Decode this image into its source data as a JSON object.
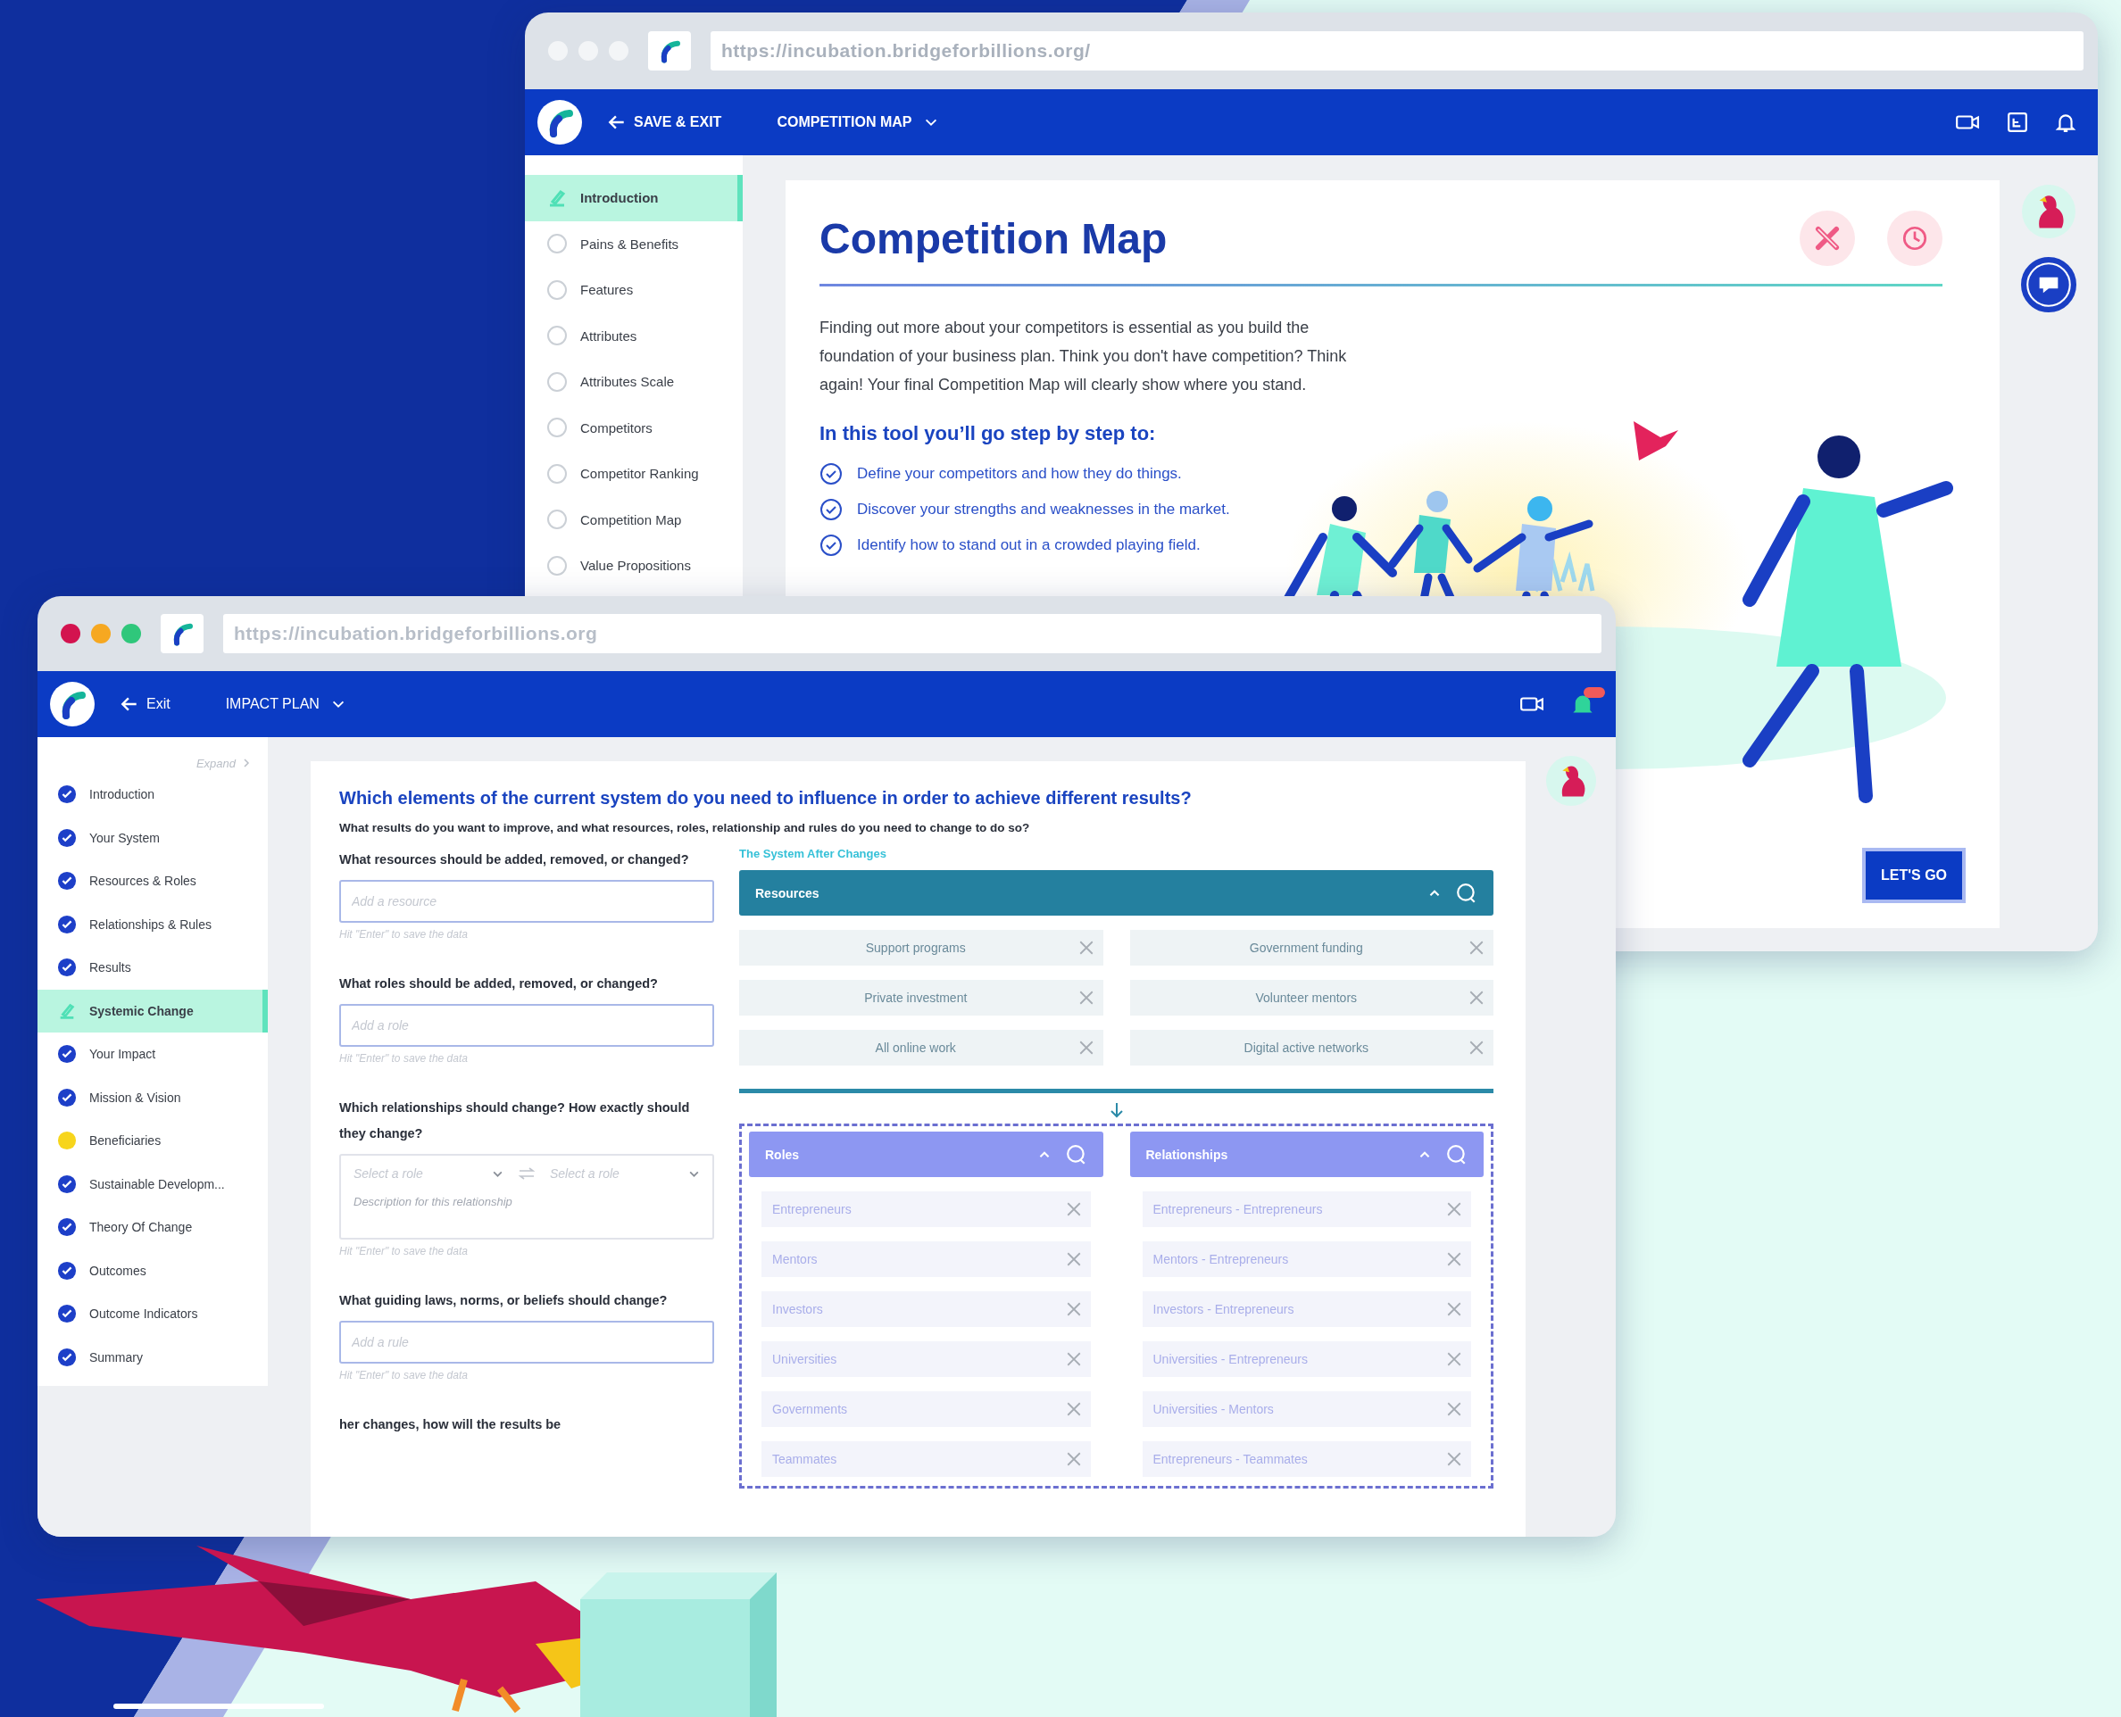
{
  "back_window": {
    "url": "https://incubation.bridgeforbillions.org/",
    "nav": {
      "back_label": "SAVE & EXIT",
      "section": "COMPETITION MAP"
    },
    "sidebar": [
      {
        "label": "Introduction",
        "kind": "current",
        "selected": true
      },
      {
        "label": "Pains & Benefits",
        "kind": "todo",
        "selected": false
      },
      {
        "label": "Features",
        "kind": "todo",
        "selected": false
      },
      {
        "label": "Attributes",
        "kind": "todo",
        "selected": false
      },
      {
        "label": "Attributes Scale",
        "kind": "todo",
        "selected": false
      },
      {
        "label": "Competitors",
        "kind": "todo",
        "selected": false
      },
      {
        "label": "Competitor Ranking",
        "kind": "todo",
        "selected": false
      },
      {
        "label": "Competition Map",
        "kind": "todo",
        "selected": false
      },
      {
        "label": "Value Propositions",
        "kind": "todo",
        "selected": false
      }
    ],
    "title": "Competition Map",
    "intro": "Finding out more about your competitors is essential as you build the foundation of your business plan. Think you don't have competition? Think again! Your final Competition Map will clearly show where you stand.",
    "steps_heading": "In this tool you’ll go step by step to:",
    "steps": [
      "Define your competitors and how they do things.",
      "Discover your strengths and weaknesses in the market.",
      "Identify how to stand out in a crowded playing field."
    ],
    "primary_button": "LET'S GO"
  },
  "front_window": {
    "url": "https://incubation.bridgeforbillions.org",
    "nav": {
      "back_label": "Exit",
      "section": "IMPACT PLAN"
    },
    "sidebar": {
      "expand": "Expand",
      "items": [
        {
          "label": "Introduction",
          "kind": "done",
          "selected": false
        },
        {
          "label": "Your System",
          "kind": "done",
          "selected": false
        },
        {
          "label": "Resources & Roles",
          "kind": "done",
          "selected": false
        },
        {
          "label": "Relationships & Rules",
          "kind": "done",
          "selected": false
        },
        {
          "label": "Results",
          "kind": "done",
          "selected": false
        },
        {
          "label": "Systemic Change",
          "kind": "current",
          "selected": true
        },
        {
          "label": "Your Impact",
          "kind": "done",
          "selected": false
        },
        {
          "label": "Mission & Vision",
          "kind": "done",
          "selected": false
        },
        {
          "label": "Beneficiaries",
          "kind": "partial",
          "selected": false
        },
        {
          "label": "Sustainable Developm...",
          "kind": "done",
          "selected": false
        },
        {
          "label": "Theory Of Change",
          "kind": "done",
          "selected": false
        },
        {
          "label": "Outcomes",
          "kind": "done",
          "selected": false
        },
        {
          "label": "Outcome Indicators",
          "kind": "done",
          "selected": false
        },
        {
          "label": "Summary",
          "kind": "done",
          "selected": false
        }
      ]
    },
    "question": "Which elements of the current system do you need to influence in order to achieve different results?",
    "subquestion": "What results do you want to improve, and what resources, roles, relationship and rules do you need to change to do so?",
    "fields": [
      {
        "kind": "text",
        "label": "What resources should be added, removed, or changed?",
        "placeholder": "Add a resource",
        "hint": "Hit \"Enter\" to save the data"
      },
      {
        "kind": "text",
        "label": "What roles should be added, removed, or changed?",
        "placeholder": "Add a role",
        "hint": "Hit \"Enter\" to save the data"
      },
      {
        "kind": "relationship",
        "label": "Which relationships should change? How exactly should they change?",
        "from_placeholder": "Select a role",
        "to_placeholder": "Select a role",
        "description_placeholder": "Description for this relationship",
        "hint": "Hit \"Enter\" to save the data"
      },
      {
        "kind": "text",
        "label": "What guiding laws, norms, or beliefs should change?",
        "placeholder": "Add a rule",
        "hint": "Hit \"Enter\" to save the data"
      },
      {
        "kind": "question_only",
        "label": "her changes, how will the results be"
      }
    ],
    "system_panel": {
      "title": "The System After Changes",
      "resources": {
        "title": "Resources",
        "items": [
          "Support programs",
          "Government funding",
          "Private investment",
          "Volunteer mentors",
          "All online work",
          "Digital active networks"
        ]
      },
      "roles": {
        "title": "Roles",
        "items": [
          "Entrepreneurs",
          "Mentors",
          "Investors",
          "Universities",
          "Governments",
          "Teammates"
        ]
      },
      "relationships": {
        "title": "Relationships",
        "items": [
          "Entrepreneurs - Entrepreneurs",
          "Mentors - Entrepreneurs",
          "Investors - Entrepreneurs",
          "Universities - Entrepreneurs",
          "Universities - Mentors",
          "Entrepreneurs - Teammates"
        ]
      }
    }
  }
}
